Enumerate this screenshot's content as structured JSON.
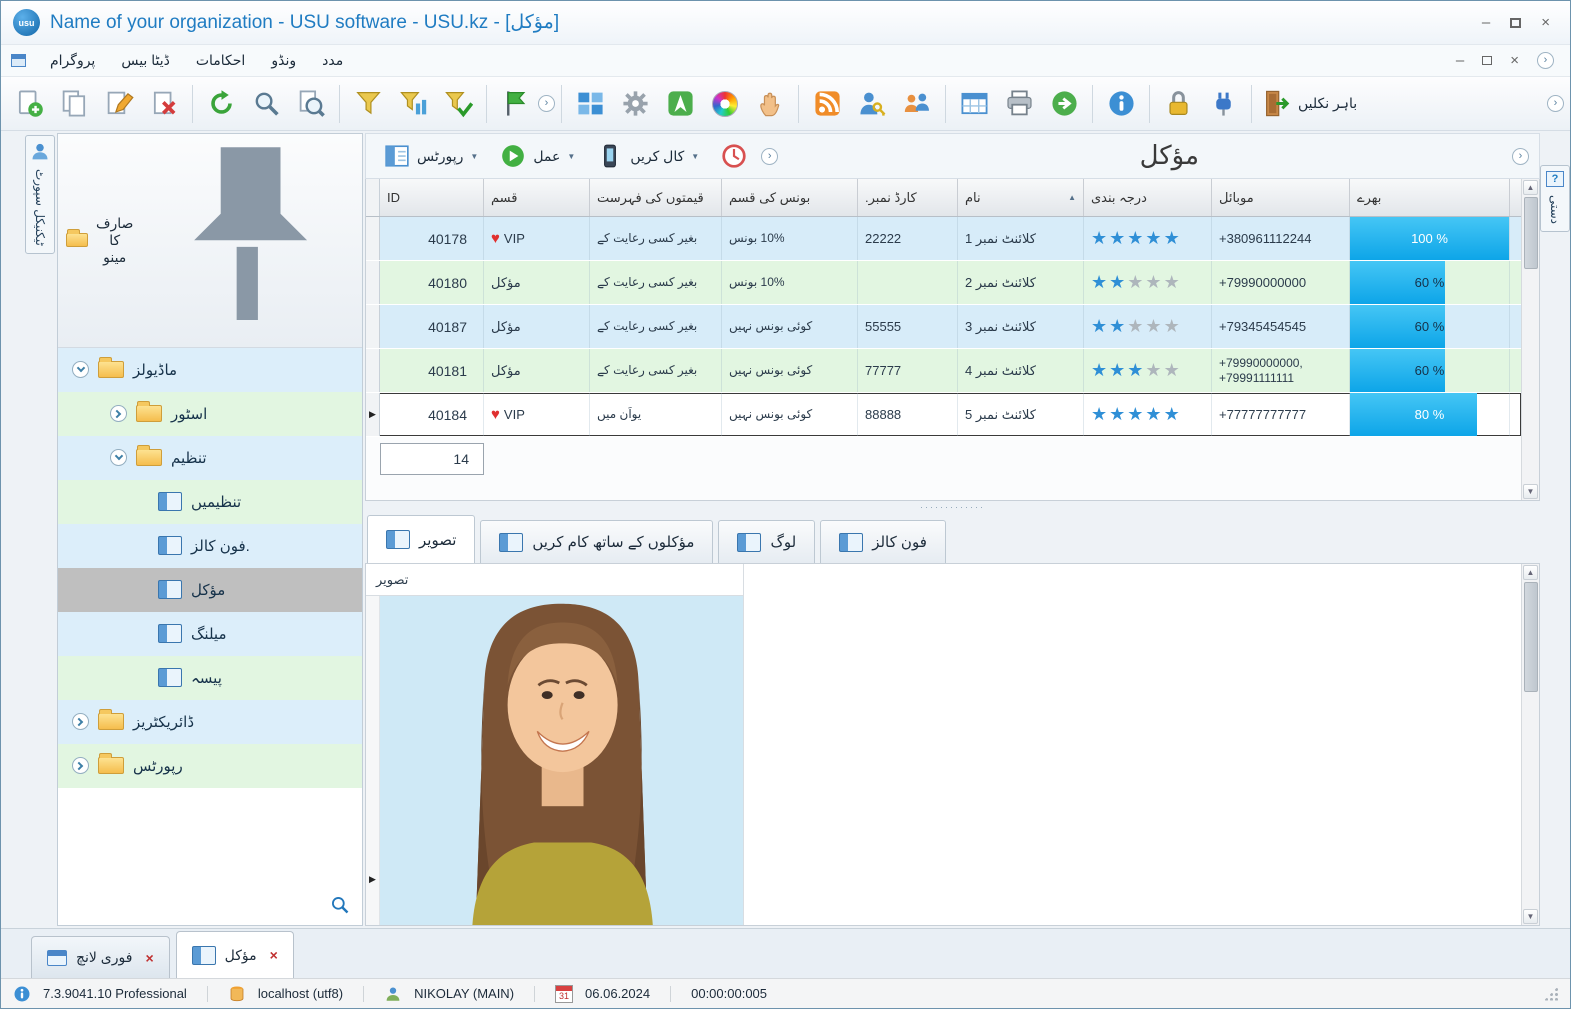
{
  "window": {
    "title": "Name of your organization - USU software - USU.kz - [مؤکل]"
  },
  "menubar": {
    "items": [
      "پروگرام",
      "ڈیٹا بیس",
      "احکامات",
      "ونڈو",
      "مدد"
    ]
  },
  "toolbar": {
    "exit_label": "باہر نکلیں",
    "icons": [
      "add-record",
      "copy-record",
      "edit-record",
      "delete-record",
      "refresh",
      "search",
      "search-in-list",
      "filter",
      "filter-columns",
      "filter-apply",
      "flag",
      "more",
      "grid-view",
      "settings",
      "navigator",
      "colors",
      "pan",
      "news-feed",
      "user-access",
      "employees",
      "table-export",
      "print",
      "go-to",
      "information",
      "lock",
      "plugins",
      "exit"
    ]
  },
  "support_tab": "ٹیکنیکل سپورٹ",
  "manual_tab": "دستی",
  "tree": {
    "title": "صارف کا مینو",
    "items": [
      {
        "label": "ماڈیولز"
      },
      {
        "label": "اسٹور"
      },
      {
        "label": "تنظیم"
      },
      {
        "label": "تنظیمیں"
      },
      {
        "label": "فون کالز."
      },
      {
        "label": "مؤکل"
      },
      {
        "label": "میلنگ"
      },
      {
        "label": "پیسہ"
      },
      {
        "label": "ڈائریکٹریز"
      },
      {
        "label": "رپورٹس"
      }
    ]
  },
  "subtoolbar": {
    "reports_label": "رپورٹس",
    "action_label": "عمل",
    "call_label": "کال کریں",
    "page_title": "مؤکل"
  },
  "table": {
    "columns": {
      "id": "ID",
      "type": "قسم",
      "pricelist": "قیمتوں کی فہرست",
      "bonus": "بونس کی قسم",
      "card": "کارڈ نمبر.",
      "name": "نام",
      "rating": "درجہ بندی",
      "mobile": "موبائل",
      "fill": "بھرے"
    },
    "rows": [
      {
        "id": "40178",
        "vip": true,
        "type": "VIP",
        "pricelist": "بغیر کسی رعایت کے",
        "bonus": "10% بونس",
        "card": "22222",
        "name": "کلائنٹ نمبر 1",
        "stars": 5,
        "mobile": "+380961112244",
        "fill": 100,
        "fill_label": "100 %"
      },
      {
        "id": "40180",
        "vip": false,
        "type": "مؤکل",
        "pricelist": "بغیر کسی رعایت کے",
        "bonus": "10% بونس",
        "card": "",
        "name": "کلائنٹ نمبر 2",
        "stars": 2,
        "mobile": "+79990000000",
        "fill": 60,
        "fill_label": "60 %"
      },
      {
        "id": "40187",
        "vip": false,
        "type": "مؤکل",
        "pricelist": "بغیر کسی رعایت کے",
        "bonus": "کوئی بونس نہیں",
        "card": "55555",
        "name": "کلائنٹ نمبر 3",
        "stars": 2,
        "mobile": "+79345454545",
        "fill": 60,
        "fill_label": "60 %"
      },
      {
        "id": "40181",
        "vip": false,
        "type": "مؤکل",
        "pricelist": "بغیر کسی رعایت کے",
        "bonus": "کوئی بونس نہیں",
        "card": "77777",
        "name": "کلائنٹ نمبر 4",
        "stars": 3,
        "mobile": "+79990000000,\n+79991111111",
        "fill": 60,
        "fill_label": "60 %"
      },
      {
        "id": "40184",
        "vip": true,
        "type": "VIP",
        "pricelist": "یواَن میں",
        "bonus": "کوئی بونس نہیں",
        "card": "88888",
        "name": "کلائنٹ نمبر 5",
        "stars": 5,
        "mobile": "+77777777777",
        "fill": 80,
        "fill_label": "80 %"
      }
    ],
    "summary_count": "14"
  },
  "detail_tabs": [
    {
      "label": "تصویر"
    },
    {
      "label": "مؤکلوں کے ساتھ کام کریں"
    },
    {
      "label": "لوگ"
    },
    {
      "label": "فون کالز"
    }
  ],
  "picture_panel": {
    "header": "تصویر"
  },
  "doc_tabs": [
    {
      "label": "فوری لانچ"
    },
    {
      "label": "مؤکل"
    }
  ],
  "statusbar": {
    "version": "7.3.9041.10 Professional",
    "database": "localhost (utf8)",
    "user": "NIKOLAY (MAIN)",
    "calendar_day": "31",
    "date": "06.06.2024",
    "timer": "00:00:00:005"
  }
}
